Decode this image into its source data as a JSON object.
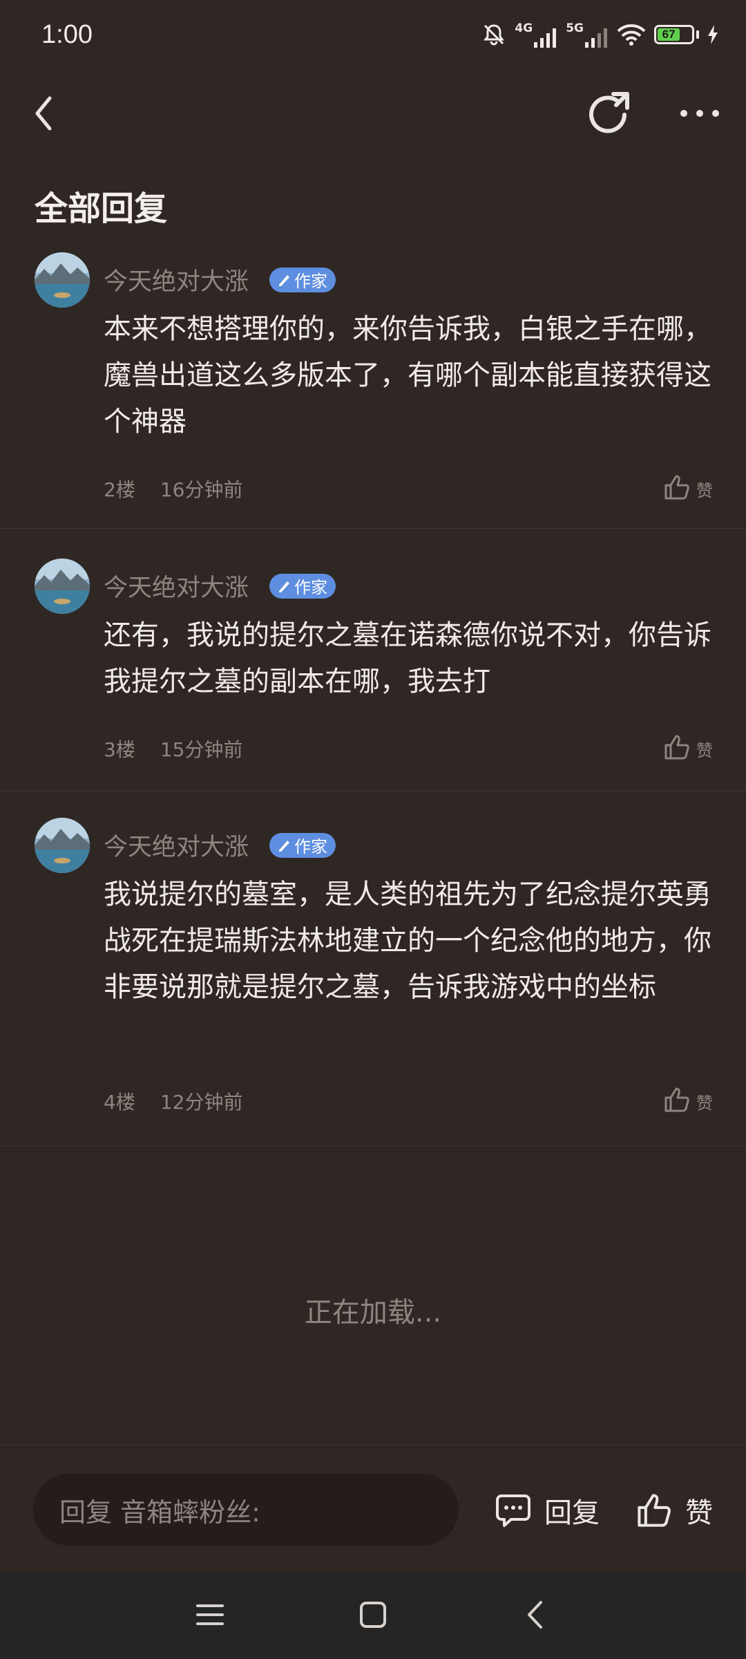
{
  "status_bar": {
    "time": "1:00",
    "network_1": "4G",
    "network_2": "5G",
    "battery": "67",
    "battery_level": 0.67,
    "icons": [
      "mute-bell-icon",
      "signal-icon",
      "wifi-icon",
      "battery-icon",
      "charging-icon"
    ]
  },
  "nav": {
    "icons": [
      "back-icon",
      "refresh-icon",
      "more-icon"
    ]
  },
  "section_title": "全部回复",
  "replies": [
    {
      "author": "今天绝对大涨",
      "badge": "作家",
      "content": "本来不想搭理你的，来你告诉我，白银之手在哪，魔兽出道这么多版本了，有哪个副本能直接获得这个神器",
      "floor": "2楼",
      "time": "16分钟前",
      "like_label": "赞"
    },
    {
      "author": "今天绝对大涨",
      "badge": "作家",
      "content": "还有，我说的提尔之墓在诺森德你说不对，你告诉我提尔之墓的副本在哪，我去打",
      "floor": "3楼",
      "time": "15分钟前",
      "like_label": "赞"
    },
    {
      "author": "今天绝对大涨",
      "badge": "作家",
      "content": "我说提尔的墓室，是人类的祖先为了纪念提尔英勇战死在提瑞斯法林地建立的一个纪念他的地方，你非要说那就是提尔之墓，告诉我游戏中的坐标",
      "floor": "4楼",
      "time": "12分钟前",
      "like_label": "赞"
    }
  ],
  "loading_text": "正在加载...",
  "bottom_bar": {
    "reply_placeholder": "回复 音箱蟀粉丝:",
    "reply_label": "回复",
    "like_label": "赞"
  },
  "system_nav": [
    "menu-icon",
    "home-icon",
    "back-icon"
  ],
  "colors": {
    "background": "#2e2724",
    "badge": "#5d8ee0",
    "input_background": "#241d1b",
    "battery": "#5fd04d"
  }
}
